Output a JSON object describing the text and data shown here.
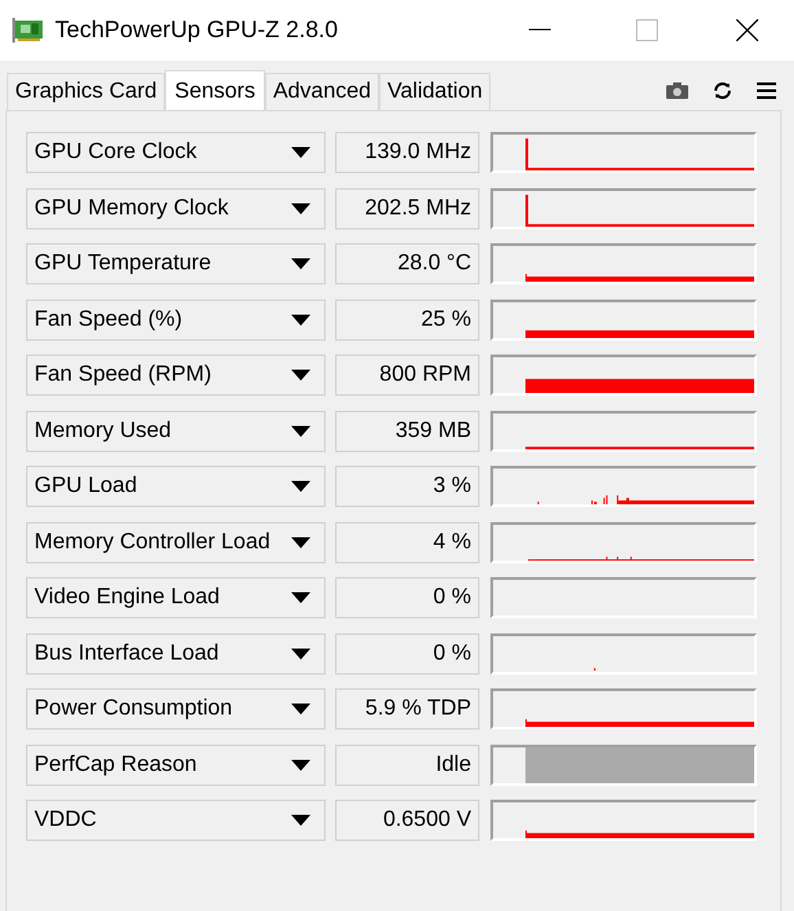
{
  "window": {
    "title": "TechPowerUp GPU-Z 2.8.0"
  },
  "tabs": [
    {
      "label": "Graphics Card",
      "selected": false
    },
    {
      "label": "Sensors",
      "selected": true
    },
    {
      "label": "Advanced",
      "selected": false
    },
    {
      "label": "Validation",
      "selected": false
    }
  ],
  "sensors": [
    {
      "name": "GPU Core Clock",
      "value": "139.0 MHz",
      "kind": "spike"
    },
    {
      "name": "GPU Memory Clock",
      "value": "202.5 MHz",
      "kind": "spike"
    },
    {
      "name": "GPU Temperature",
      "value": "28.0 °C",
      "kind": "thin"
    },
    {
      "name": "Fan Speed (%)",
      "value": "25 %",
      "kind": "band"
    },
    {
      "name": "Fan Speed (RPM)",
      "value": "800 RPM",
      "kind": "thick"
    },
    {
      "name": "Memory Used",
      "value": "359 MB",
      "kind": "line"
    },
    {
      "name": "GPU Load",
      "value": "3 %",
      "kind": "noise"
    },
    {
      "name": "Memory Controller Load",
      "value": "4 %",
      "kind": "ticks"
    },
    {
      "name": "Video Engine Load",
      "value": "0 %",
      "kind": "empty"
    },
    {
      "name": "Bus Interface Load",
      "value": "0 %",
      "kind": "dot"
    },
    {
      "name": "Power Consumption",
      "value": "5.9 % TDP",
      "kind": "thin"
    },
    {
      "name": "PerfCap Reason",
      "value": "Idle",
      "kind": "block"
    },
    {
      "name": "VDDC",
      "value": "0.6500 V",
      "kind": "thin"
    }
  ]
}
